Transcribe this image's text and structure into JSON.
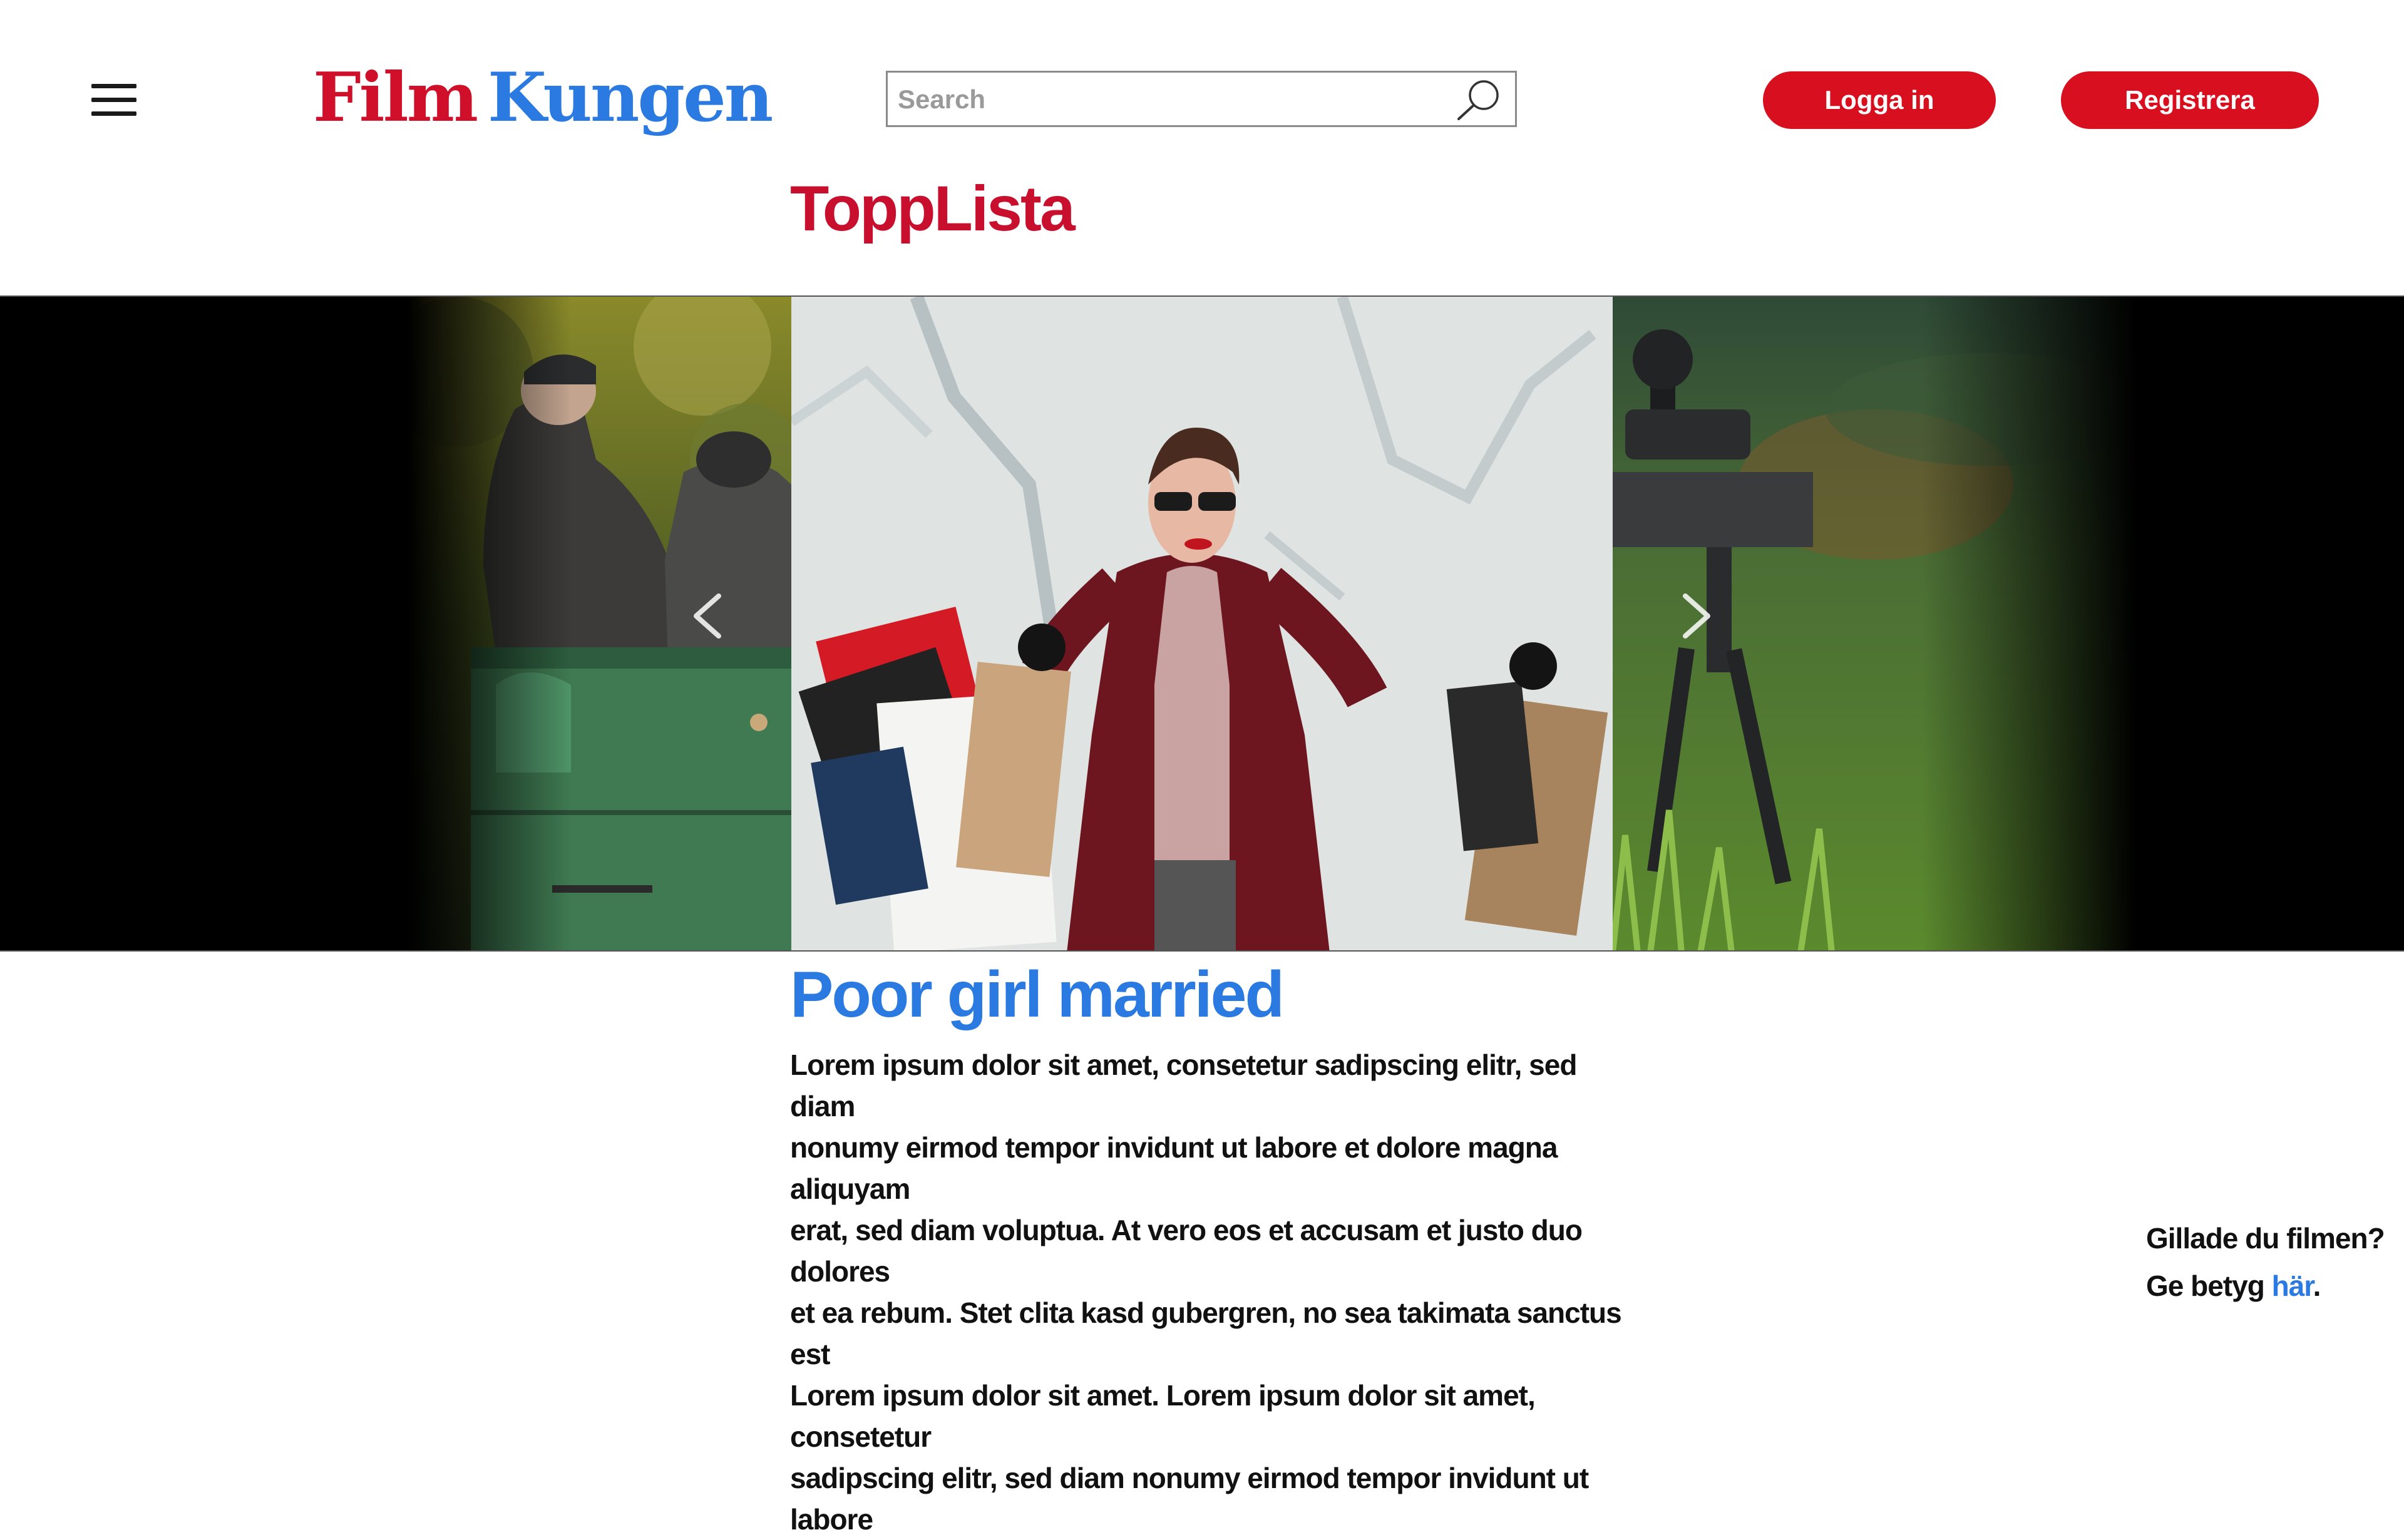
{
  "header": {
    "logo": {
      "part1": "Film",
      "part2": "Kungen"
    },
    "search": {
      "placeholder": "Search",
      "value": ""
    },
    "login_label": "Logga in",
    "register_label": "Registrera"
  },
  "section": {
    "title": "ToppLista"
  },
  "carousel": {
    "slides": [
      {
        "position": "previous",
        "image": "man-driving-horse-carriage"
      },
      {
        "position": "current",
        "image": "woman-sunglasses-shopping-bags"
      },
      {
        "position": "next",
        "image": "sniper-rifle-scope-grass"
      }
    ],
    "prev_icon": "chevron-left-icon",
    "next_icon": "chevron-right-icon"
  },
  "movie": {
    "title": "Poor girl married",
    "description_lines": [
      "Lorem ipsum dolor sit amet, consetetur sadipscing elitr, sed diam",
      "nonumy eirmod tempor invidunt ut labore et dolore magna aliquyam",
      "erat, sed diam voluptua. At vero eos et accusam et justo duo dolores",
      "et ea rebum. Stet clita kasd gubergren, no sea takimata sanctus est",
      "Lorem ipsum dolor sit amet. Lorem ipsum dolor sit amet, consetetur",
      "sadipscing elitr, sed diam nonumy eirmod tempor invidunt ut labore"
    ]
  },
  "rating_prompt": {
    "question": "Gillade du filmen?",
    "prefix": "Ge betyg ",
    "link": "här",
    "suffix": "."
  },
  "colors": {
    "brand_red": "#d0102a",
    "button_red": "#d80f1f",
    "title_red": "#c8102e",
    "link_blue": "#2a7ae2"
  }
}
